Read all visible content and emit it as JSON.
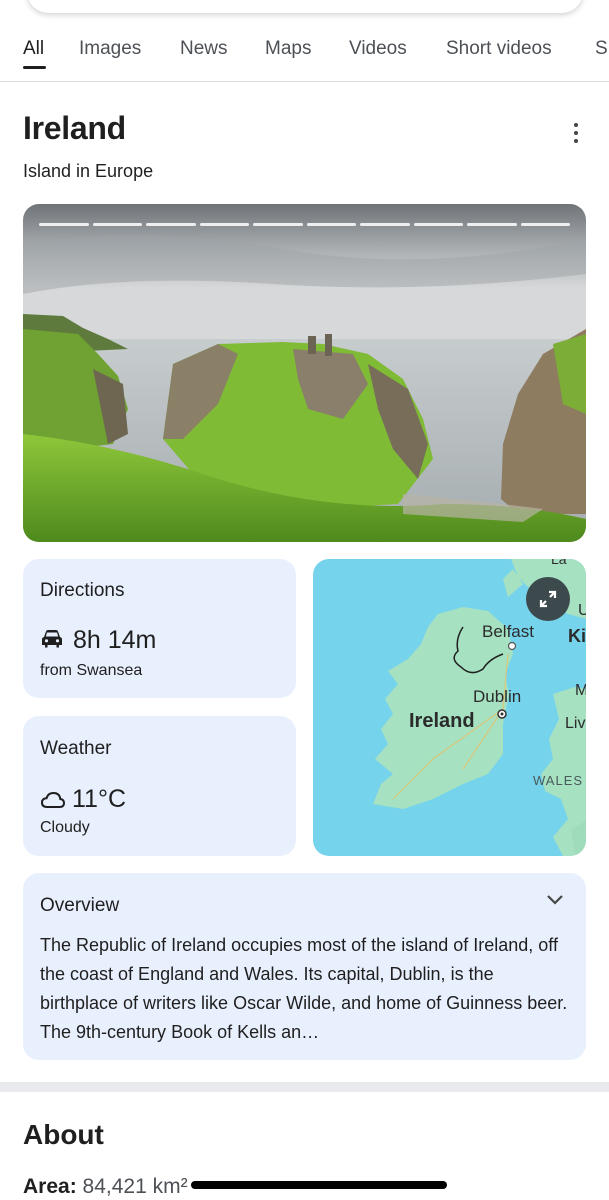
{
  "tabs": [
    "All",
    "Images",
    "News",
    "Maps",
    "Videos",
    "Short videos",
    "S"
  ],
  "entity": {
    "title": "Ireland",
    "subtitle": "Island in Europe"
  },
  "directions": {
    "title": "Directions",
    "time": "8h 14m",
    "from": "from Swansea"
  },
  "weather": {
    "title": "Weather",
    "temp": "11°C",
    "condition": "Cloudy"
  },
  "map": {
    "labels": {
      "belfast": "Belfast",
      "dublin": "Dublin",
      "ireland": "Ireland",
      "wales": "WALES",
      "ki": "Ki",
      "liv": "Liv",
      "m": "M",
      "u": "U",
      "la": "La"
    }
  },
  "overview": {
    "title": "Overview",
    "text": "The Republic of Ireland occupies most of the island of Ireland, off the coast of England and Wales. Its capital, Dublin, is the birthplace of writers like Oscar Wilde, and home of Guinness beer. The 9th-century Book of Kells an…"
  },
  "about": {
    "title": "About",
    "area_label": "Area:",
    "area_value": "84,421 km²"
  },
  "colors": {
    "card_bg": "#e8effd",
    "map_sea": "#76d3ec",
    "map_land": "#a6e1c2"
  }
}
